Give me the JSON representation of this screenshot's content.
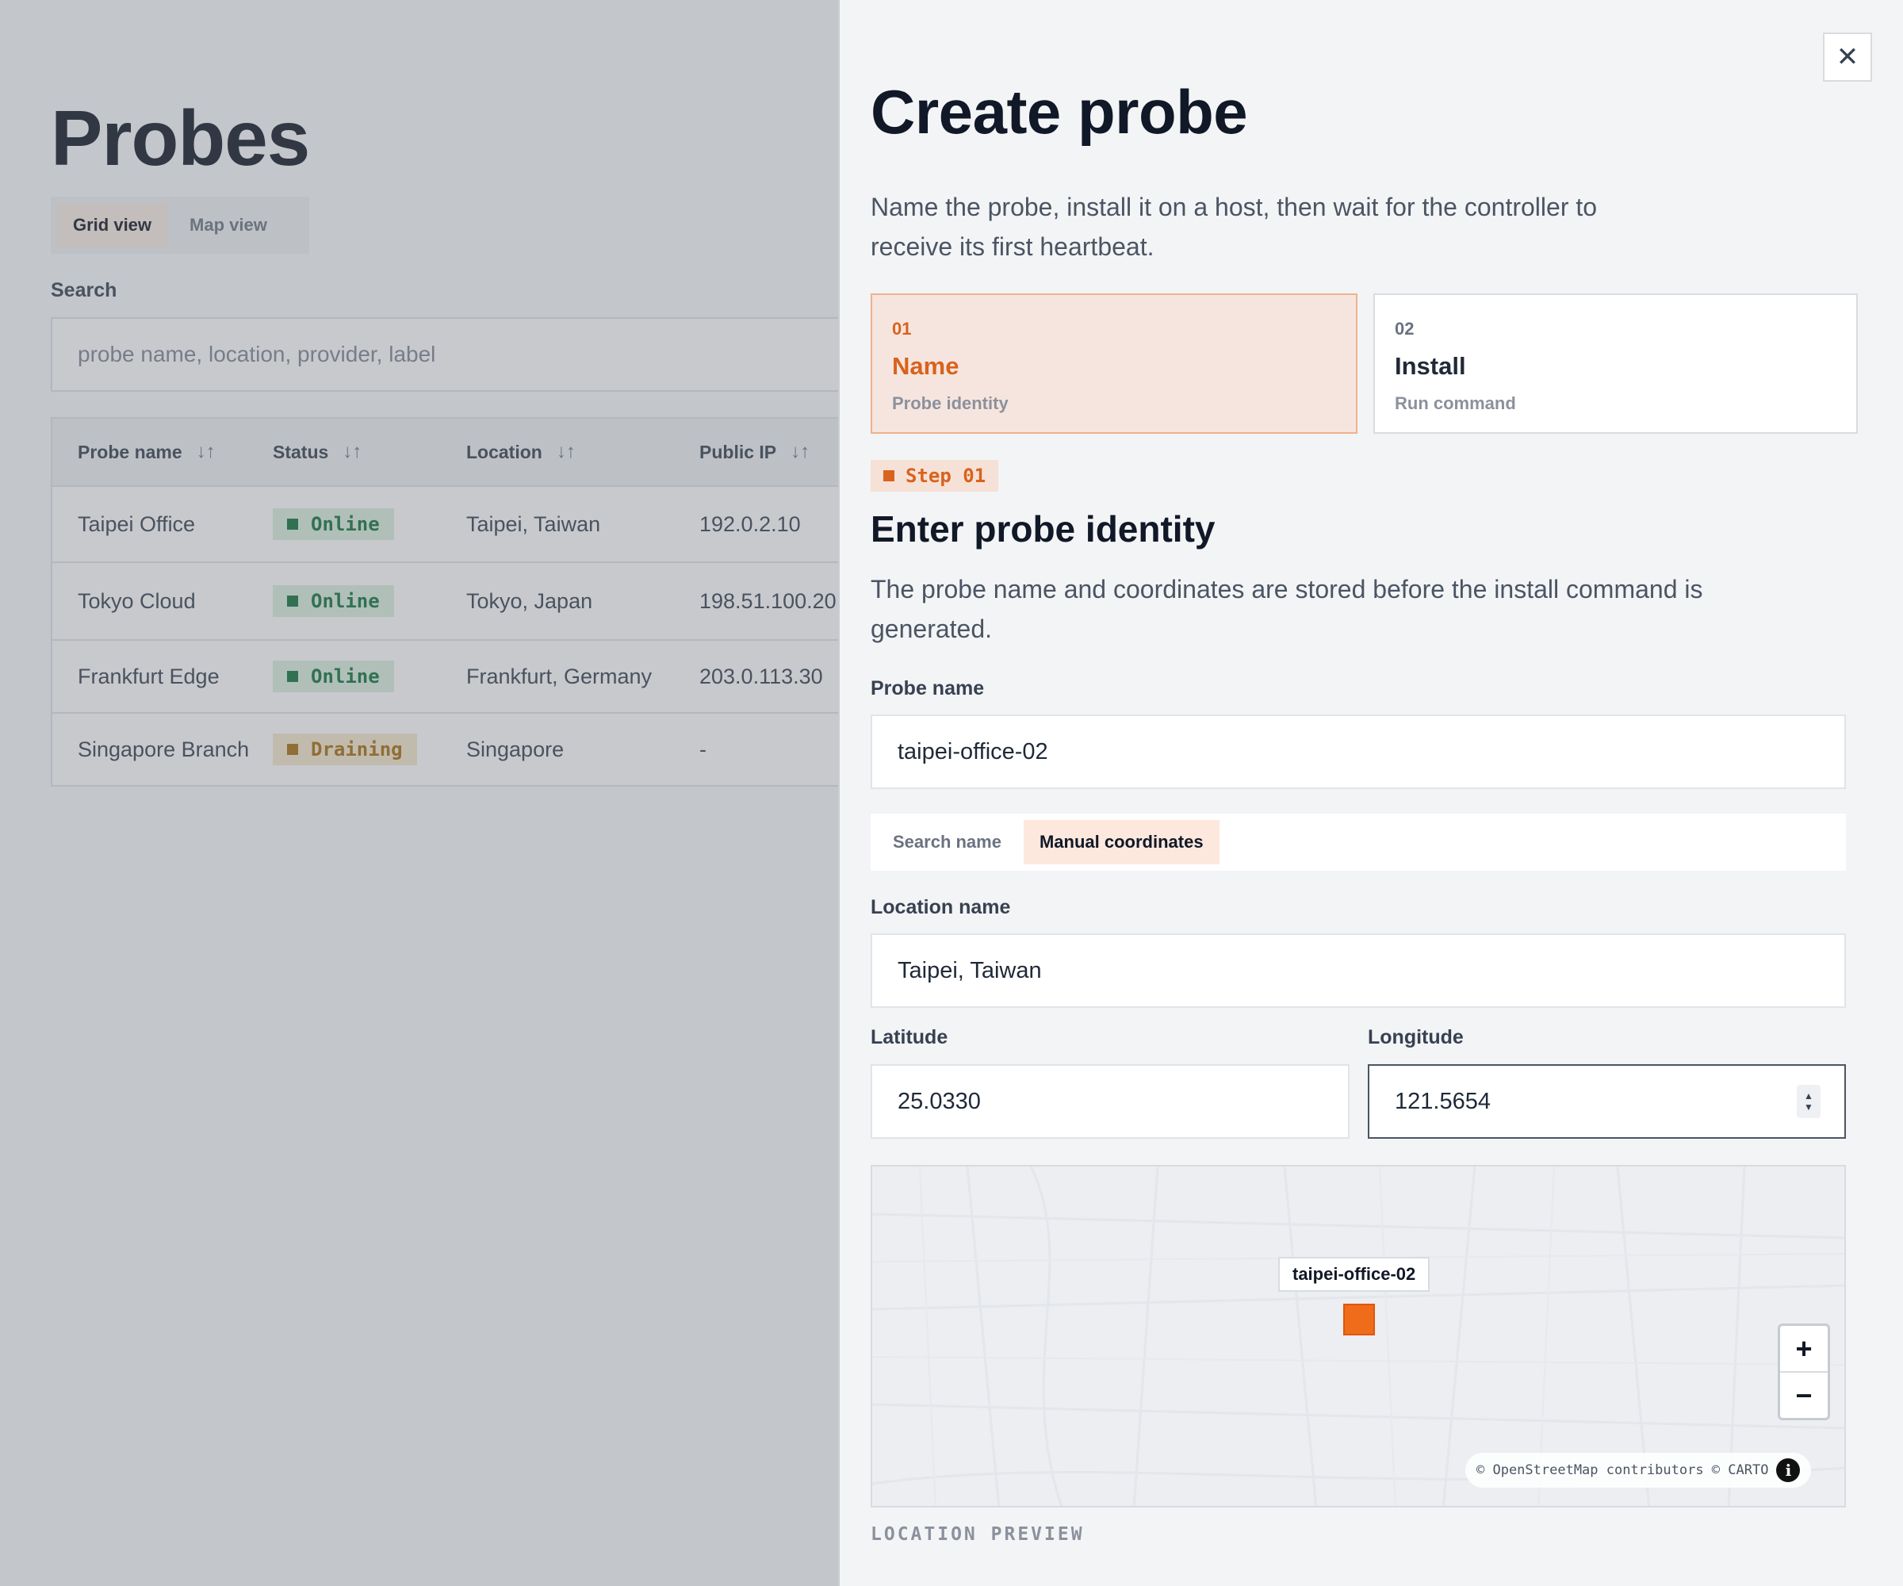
{
  "background": {
    "title": "Probes",
    "views": [
      {
        "label": "Grid view",
        "active": true
      },
      {
        "label": "Map view",
        "active": false
      }
    ],
    "search": {
      "label": "Search",
      "placeholder": "probe name, location, provider, label"
    },
    "table": {
      "columns": [
        "Probe name",
        "Status",
        "Location",
        "Public IP"
      ],
      "sort_icon": "↓↑",
      "rows": [
        {
          "name": "Taipei Office",
          "status": "Online",
          "status_kind": "online",
          "location": "Taipei, Taiwan",
          "ip": "192.0.2.10"
        },
        {
          "name": "Tokyo Cloud",
          "status": "Online",
          "status_kind": "online",
          "location": "Tokyo, Japan",
          "ip": "198.51.100.20"
        },
        {
          "name": "Frankfurt Edge",
          "status": "Online",
          "status_kind": "online",
          "location": "Frankfurt, Germany",
          "ip": "203.0.113.30"
        },
        {
          "name": "Singapore Branch",
          "status": "Draining",
          "status_kind": "draining",
          "location": "Singapore",
          "ip": "-"
        }
      ]
    }
  },
  "drawer": {
    "close_icon": "✕",
    "title": "Create probe",
    "description": "Name the probe, install it on a host, then wait for the controller to receive its first heartbeat.",
    "steps": [
      {
        "number": "01",
        "name": "Name",
        "subtitle": "Probe identity",
        "active": true
      },
      {
        "number": "02",
        "name": "Install",
        "subtitle": "Run command",
        "active": false
      }
    ],
    "step_tag": "Step 01",
    "section_title": "Enter probe identity",
    "section_description": "The probe name and coordinates are stored before the install command is generated.",
    "probe_name": {
      "label": "Probe name",
      "value": "taipei-office-02"
    },
    "location_modes": [
      {
        "label": "Search name",
        "active": false
      },
      {
        "label": "Manual coordinates",
        "active": true
      }
    ],
    "location_name": {
      "label": "Location name",
      "value": "Taipei, Taiwan"
    },
    "latitude": {
      "label": "Latitude",
      "value": "25.0330"
    },
    "longitude": {
      "label": "Longitude",
      "value": "121.5654"
    },
    "map": {
      "marker_label": "taipei-office-02",
      "zoom_in": "+",
      "zoom_out": "−",
      "attribution": "© OpenStreetMap contributors © CARTO",
      "info_icon": "i",
      "caption": "LOCATION PREVIEW"
    }
  },
  "colors": {
    "accent": "#d9621d",
    "marker": "#ef6c1a",
    "online": "#12703e",
    "draining": "#a26b13"
  }
}
